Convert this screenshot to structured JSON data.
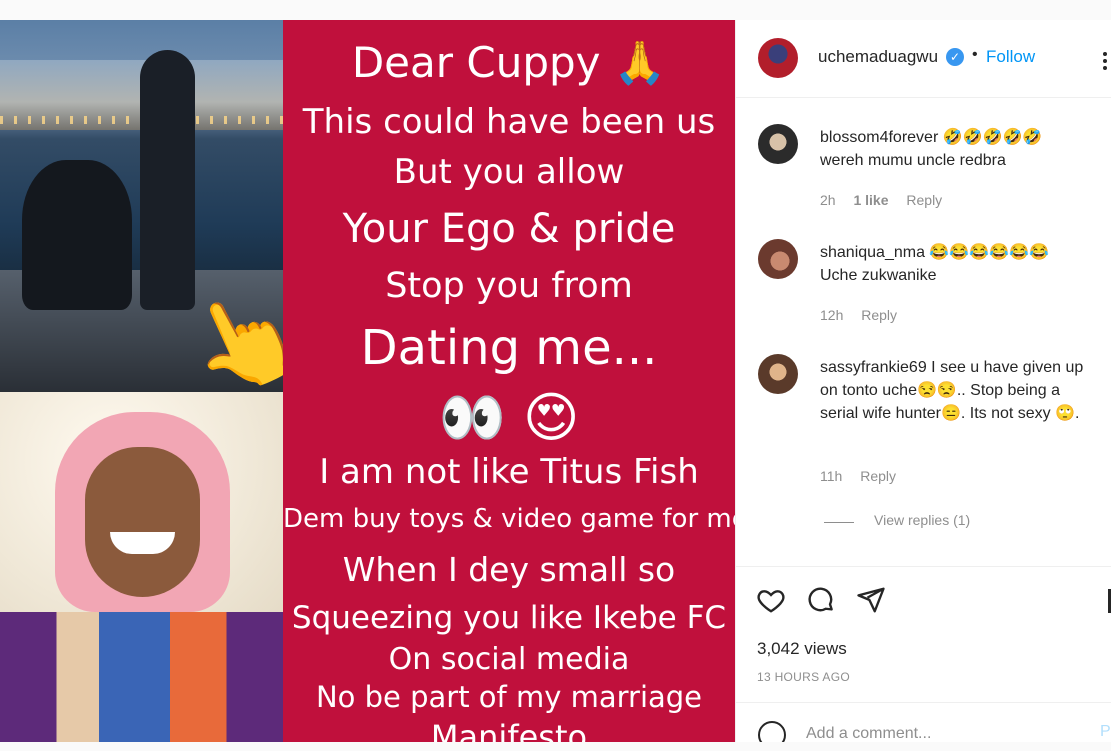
{
  "post": {
    "image_text_lines": [
      "Dear Cuppy 🙏",
      "This could have been us",
      "But you allow",
      "Your Ego & pride",
      "Stop you from",
      "Dating me...",
      "👀 😍",
      "I am not like Titus Fish",
      "Dem buy toys & video game for me",
      "When I dey small so",
      "Squeezing you like Ikebe FC",
      "On social media",
      "No be part of my marriage",
      "Manifesto"
    ],
    "pointing_emoji": "👆"
  },
  "header": {
    "username": "uchemaduagwu",
    "verified_mark": "✓",
    "separator": "•",
    "follow_label": "Follow"
  },
  "comments": [
    {
      "username": "blossom4forever",
      "text": "🤣🤣🤣🤣🤣",
      "text2": "wereh mumu uncle redbra",
      "time": "2h",
      "likes": "1 like",
      "reply": "Reply",
      "avatar_color": "#2b2b2b"
    },
    {
      "username": "shaniqua_nma",
      "text": "😂😂😂😂😂😂",
      "text2": "Uche zukwanike",
      "time": "12h",
      "reply": "Reply",
      "avatar_color": "#6b3a2e"
    },
    {
      "username": "sassyfrankie69",
      "text": "I see u have given up on tonto uche😒😒.. Stop being a serial wife hunter😑. Its not sexy 🙄.",
      "time": "11h",
      "reply": "Reply",
      "avatar_color": "#5a3a2a",
      "view_replies": "View replies (1)"
    }
  ],
  "actions": {
    "views": "3,042 views",
    "time_ago": "13 HOURS AGO"
  },
  "add_comment": {
    "placeholder": "Add a comment...",
    "post_label": "P"
  },
  "colors": {
    "panel_red": "#c0103c",
    "link_blue": "#0095f6",
    "verified_blue": "#3897f0"
  }
}
